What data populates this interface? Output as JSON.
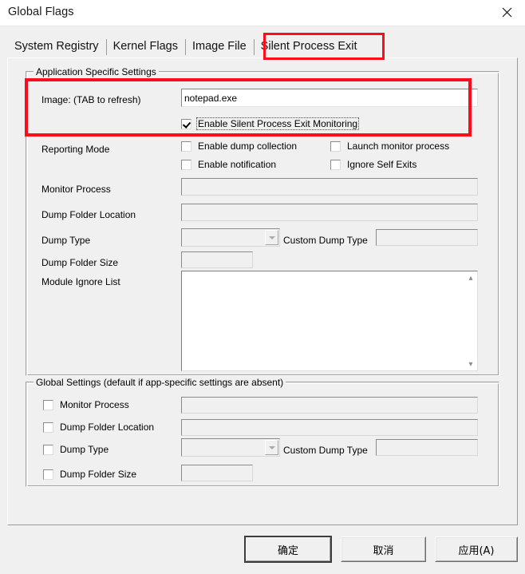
{
  "window": {
    "title": "Global Flags",
    "close_icon": "close-icon"
  },
  "tabs": [
    {
      "label": "System Registry",
      "active": false
    },
    {
      "label": "Kernel Flags",
      "active": false
    },
    {
      "label": "Image File",
      "active": false
    },
    {
      "label": "Silent Process Exit",
      "active": true
    }
  ],
  "app_specific": {
    "title": "Application Specific Settings",
    "image_label": "Image:  (TAB to refresh)",
    "image_value": "notepad.exe",
    "image_placeholder": "",
    "enable_monitoring": {
      "label": "Enable Silent Process Exit Monitoring",
      "checked": true,
      "focused": true
    },
    "reporting_mode_label": "Reporting Mode",
    "reporting_checkboxes": [
      {
        "label": "Enable dump collection",
        "checked": false
      },
      {
        "label": "Launch monitor process",
        "checked": false
      },
      {
        "label": "Enable notification",
        "checked": false
      },
      {
        "label": "Ignore Self Exits",
        "checked": false
      }
    ],
    "fields": [
      {
        "label": "Monitor Process",
        "value": "",
        "enabled": false
      },
      {
        "label": "Dump Folder Location",
        "value": "",
        "enabled": false
      },
      {
        "label": "Dump Type",
        "value": "",
        "enabled": false
      },
      {
        "label": "Dump Folder Size",
        "value": "",
        "enabled": false
      },
      {
        "label": "Module Ignore List",
        "value": "",
        "enabled": true
      }
    ],
    "custom_dump_type_label": "Custom Dump Type",
    "custom_dump_type_value": ""
  },
  "global_settings": {
    "title": "Global Settings (default if app-specific settings are absent)",
    "rows": [
      {
        "label": "Monitor Process",
        "checked": false,
        "value": ""
      },
      {
        "label": "Dump Folder Location",
        "checked": false,
        "value": ""
      },
      {
        "label": "Dump Type",
        "checked": false,
        "value": ""
      },
      {
        "label": "Dump Folder Size",
        "checked": false,
        "value": ""
      }
    ],
    "custom_dump_type_label": "Custom Dump Type",
    "custom_dump_type_value": ""
  },
  "buttons": {
    "ok": "确定",
    "cancel": "取消",
    "apply": "应用(A)"
  },
  "annotations": {
    "accent_color": "#fb0d1b",
    "highlight_tab": "Silent Process Exit",
    "highlight_region": "image-and-enable-monitoring"
  }
}
